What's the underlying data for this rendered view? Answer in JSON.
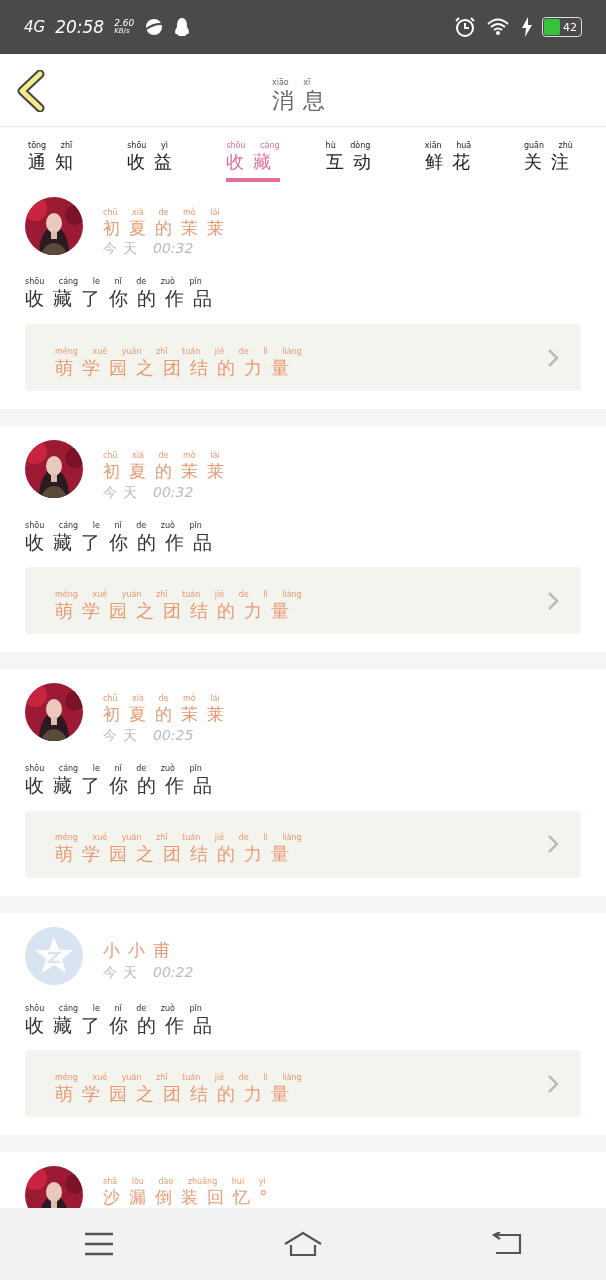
{
  "status_bar": {
    "network": "4G",
    "time": "20:58",
    "speed_value": "2.60",
    "speed_unit": "KB/s",
    "battery": "42"
  },
  "header": {
    "title": "消息",
    "title_pinyin": "xiāo xī"
  },
  "tabs": [
    {
      "label": "通知",
      "pinyin": "tōng zhī",
      "selected": false
    },
    {
      "label": "收益",
      "pinyin": "shōu yì",
      "selected": false
    },
    {
      "label": "收藏",
      "pinyin": "shōu cáng",
      "selected": true
    },
    {
      "label": "互动",
      "pinyin": "hù dòng",
      "selected": false
    },
    {
      "label": "鲜花",
      "pinyin": "xiān huā",
      "selected": false
    },
    {
      "label": "关注",
      "pinyin": "guān zhù",
      "selected": false
    }
  ],
  "messages": [
    {
      "name": "初夏的茉莱",
      "name_pinyin": "chū xià de mò lái",
      "day": "今天",
      "time": "00:32",
      "action": "收藏了你的作品",
      "action_pinyin": "shōu cáng le nǐ de zuò pǐn",
      "work": "萌学园之团结的力量",
      "work_pinyin": "méng xué yuán zhī tuán jié de lì liàng"
    },
    {
      "name": "初夏的茉莱",
      "name_pinyin": "chū xià de mò lái",
      "day": "今天",
      "time": "00:32",
      "action": "收藏了你的作品",
      "action_pinyin": "shōu cáng le nǐ de zuò pǐn",
      "work": "萌学园之团结的力量",
      "work_pinyin": "méng xué yuán zhī tuán jié de lì liàng"
    },
    {
      "name": "初夏的茉莱",
      "name_pinyin": "chū xià de mò lái",
      "day": "今天",
      "time": "00:25",
      "action": "收藏了你的作品",
      "action_pinyin": "shōu cáng le nǐ de zuò pǐn",
      "work": "萌学园之团结的力量",
      "work_pinyin": "méng xué yuán zhī tuán jié de lì liàng"
    },
    {
      "avatar": {
        "kind": "default"
      },
      "name": "小小甫",
      "day": "今天",
      "time": "00:22",
      "action": "收藏了你的作品",
      "action_pinyin": "shōu cáng le nǐ de zuò pǐn",
      "work": "萌学园之团结的力量",
      "work_pinyin": "méng xué yuán zhī tuán jié de lì liàng"
    },
    {
      "name": "沙漏倒装回忆°",
      "name_pinyin": "shā lòu dào zhuāng huí yì"
    }
  ]
}
